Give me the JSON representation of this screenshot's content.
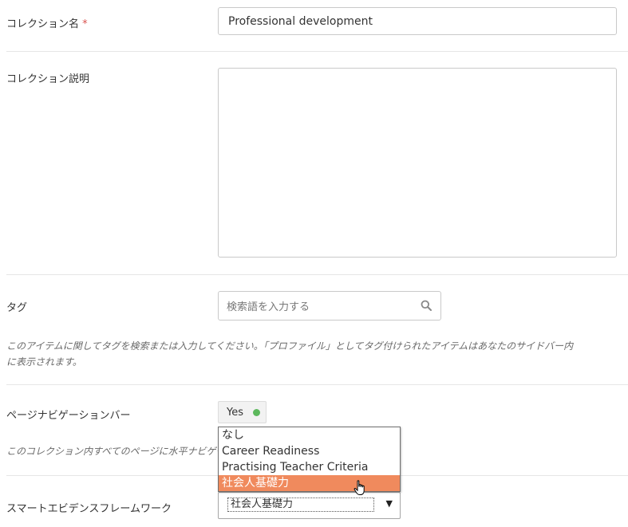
{
  "fields": {
    "collection_name": {
      "label": "コレクション名",
      "required_mark": "*",
      "value": "Professional development"
    },
    "collection_description": {
      "label": "コレクション説明",
      "value": ""
    },
    "tags": {
      "label": "タグ",
      "placeholder": "検索語を入力する",
      "icon": "search-icon",
      "help_line1": "このアイテムに関してタグを検索または入力してください。「プロファイル」としてタグ付けられたアイテムはあなたのサイドバー内",
      "help_line2": "に表示されます。"
    },
    "page_navigation": {
      "label": "ページナビゲーションバー",
      "toggle_label": "Yes",
      "status_color": "#5cb85c",
      "help": "このコレクション内すべてのページに水平ナビゲー"
    },
    "smart_evidence": {
      "label": "スマートエビデンスフレームワーク",
      "selected_value": "社会人基礎力",
      "options": [
        "なし",
        "Career Readiness",
        "Practising Teacher Criteria",
        "社会人基礎力"
      ],
      "highlight_color": "#f08a5d"
    }
  }
}
